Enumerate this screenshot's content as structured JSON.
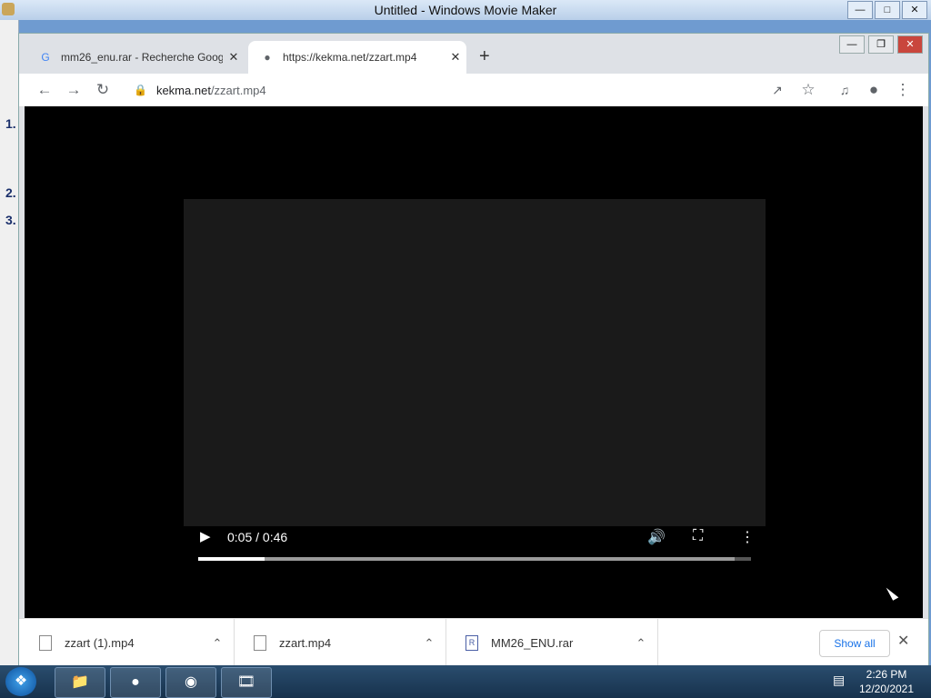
{
  "desktop_window": {
    "title": "Untitled - Windows Movie Maker",
    "side_numbers": [
      "1.",
      "2.",
      "3."
    ]
  },
  "browser": {
    "tabs": [
      {
        "label": "mm26_enu.rar - Recherche Goog",
        "favicon": "google-icon",
        "active": false
      },
      {
        "label": "https://kekma.net/zzart.mp4",
        "favicon": "globe-icon",
        "active": true
      }
    ],
    "new_tab_glyph": "+",
    "address": {
      "host": "kekma.net",
      "path": "/zzart.mp4"
    }
  },
  "player": {
    "time": "0:05 / 0:46",
    "progress_fraction": 0.12,
    "buffered_fraction": 0.97
  },
  "downloads": {
    "items": [
      {
        "name": "zzart (1).mp4",
        "icon": "file-icon"
      },
      {
        "name": "zzart.mp4",
        "icon": "file-icon"
      },
      {
        "name": "MM26_ENU.rar",
        "icon": "archive-icon"
      }
    ],
    "show_all_label": "Show all"
  },
  "taskbar": {
    "apps": [
      "explorer-icon",
      "firefox-icon",
      "chrome-icon",
      "movie-maker-icon"
    ],
    "clock_time": "2:26 PM",
    "clock_date": "12/20/2021"
  }
}
